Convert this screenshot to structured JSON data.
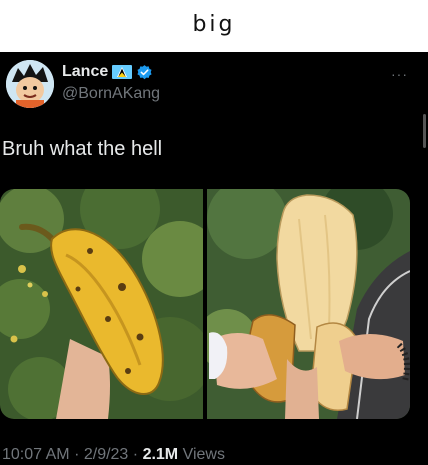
{
  "caption": "big",
  "tweet": {
    "display_name": "Lance",
    "handle": "@BornAKang",
    "text": "Bruh what the hell",
    "time": "10:07 AM",
    "separator": "·",
    "date": "2/9/23",
    "views_count": "2.1M",
    "views_label": "Views"
  },
  "icons": {
    "more": "···",
    "flag": "saint-lucia-flag-icon",
    "verified": "verified-badge-icon"
  },
  "colors": {
    "tweet_bg": "#000000",
    "text_primary": "#e7e9ea",
    "text_secondary": "#71767b",
    "verified_blue": "#1d9bf0"
  }
}
